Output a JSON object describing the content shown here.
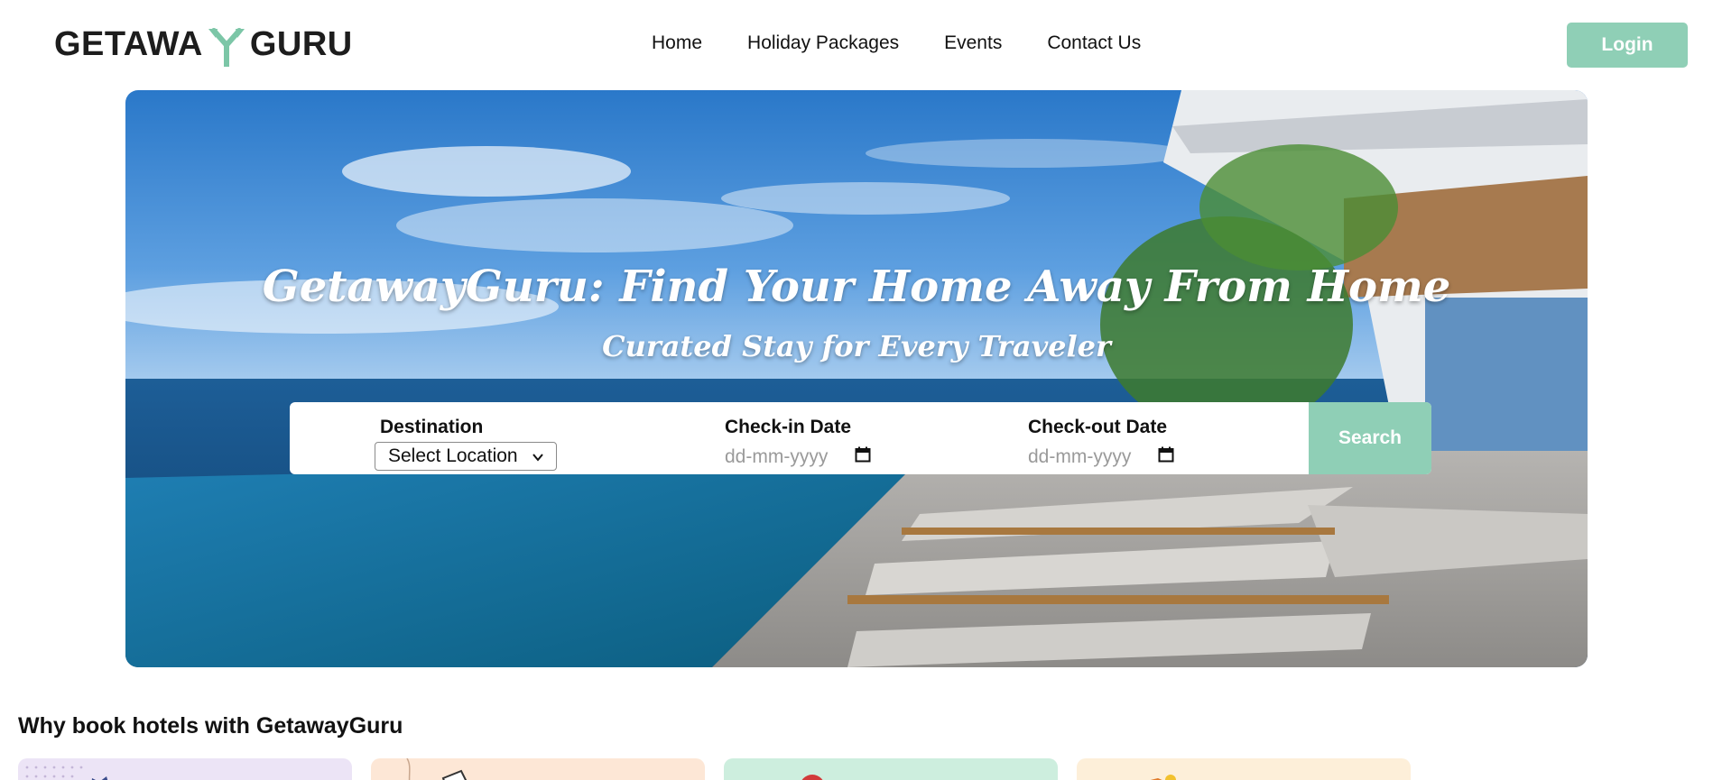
{
  "header": {
    "logo": {
      "left": "GETAWA",
      "right": "GURU",
      "icon": "y-arrow-logo-icon"
    },
    "nav": [
      "Home",
      "Holiday Packages",
      "Events",
      "Contact Us"
    ],
    "login_label": "Login"
  },
  "hero": {
    "title": "GetawayGuru: Find Your Home Away From Home",
    "subtitle": "Curated Stay for Every Traveler"
  },
  "search": {
    "destination_label": "Destination",
    "destination_value": "Select Location",
    "checkin_label": "Check-in Date",
    "checkin_placeholder": "dd-mm-yyyy",
    "checkout_label": "Check-out Date",
    "checkout_placeholder": "dd-mm-yyyy",
    "search_label": "Search"
  },
  "why": {
    "title": "Why book hotels with GetawayGuru"
  },
  "colors": {
    "accent": "#8fcfb6",
    "card_colors": [
      "#ece4f6",
      "#fde7d6",
      "#cdeede",
      "#fdefd9"
    ]
  }
}
